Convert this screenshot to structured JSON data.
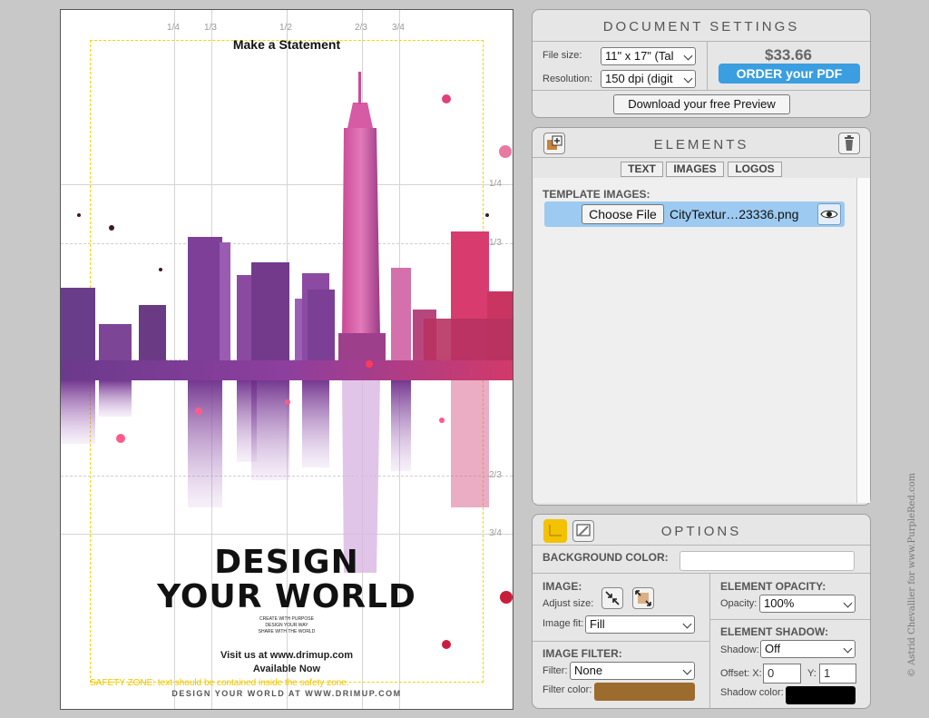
{
  "canvas": {
    "fraction_labels": [
      "1/4",
      "1/3",
      "1/2",
      "2/3",
      "3/4"
    ],
    "side_fraction_labels": [
      "1/4",
      "1/3",
      "2/3",
      "3/4"
    ],
    "heading": "Make a Statement",
    "title_line1": "DESIGN",
    "title_line2": "YOUR WORLD",
    "tagline_lines": [
      "CREATE WITH PURPOSE",
      "DESIGN YOUR WAY",
      "SHARE WITH THE WORLD"
    ],
    "visit_text": "Visit us at www.drimup.com",
    "available_text": "Available Now",
    "safety_note": "SAFETY ZONE: text should be contained inside the safety zone.",
    "footer_url": "DESIGN YOUR WORLD AT WWW.DRIMUP.COM"
  },
  "document_settings": {
    "title": "DOCUMENT SETTINGS",
    "file_size_label": "File size:",
    "file_size_value": "11\" x 17\" (Tal",
    "resolution_label": "Resolution:",
    "resolution_value": "150 dpi (digit",
    "price": "$33.66",
    "order_button": "ORDER your PDF",
    "preview_button": "Download your free Preview"
  },
  "elements": {
    "title": "ELEMENTS",
    "tabs": [
      "TEXT",
      "IMAGES",
      "LOGOS"
    ],
    "section_label": "TEMPLATE IMAGES:",
    "choose_file_button": "Choose File",
    "file_name": "CityTextur…23336.png"
  },
  "options": {
    "title": "OPTIONS",
    "background_color_label": "BACKGROUND COLOR:",
    "image_label": "IMAGE:",
    "adjust_size_label": "Adjust size:",
    "image_fit_label": "Image fit:",
    "image_fit_value": "Fill",
    "image_filter_label": "IMAGE FILTER:",
    "filter_label": "Filter:",
    "filter_value": "None",
    "filter_color_label": "Filter color:",
    "element_opacity_label": "ELEMENT OPACITY:",
    "opacity_label": "Opacity:",
    "opacity_value": "100%",
    "element_shadow_label": "ELEMENT SHADOW:",
    "shadow_label": "Shadow:",
    "shadow_value": "Off",
    "offset_x_label": "Offset: X:",
    "offset_x_value": "0",
    "y_label": "Y:",
    "y_value": "1",
    "shadow_color_label": "Shadow color:"
  },
  "colors": {
    "order_button": "#3a9ee0",
    "filter_color": "#9c6b2e",
    "shadow_color": "#000000",
    "background_color": "#ffffff",
    "accent_pink": "#e0407a",
    "accent_purple": "#7a3c9a",
    "safety_zone": "#f2d600"
  },
  "credit": "© Astrid Chevallier for www.PurpleRed.com"
}
